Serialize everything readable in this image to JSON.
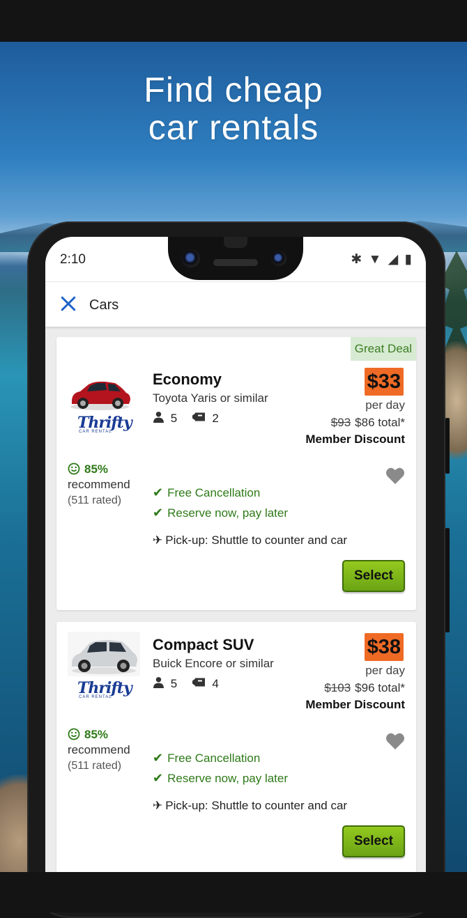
{
  "promo": {
    "headline_line1": "Find cheap",
    "headline_line2": "car rentals"
  },
  "status_bar": {
    "time": "2:10",
    "icons": [
      "bluetooth-icon",
      "wifi-icon",
      "signal-icon",
      "battery-icon"
    ]
  },
  "app_bar": {
    "title": "Cars",
    "close_icon": "close-icon"
  },
  "colors": {
    "accent": "#1b62c7",
    "price": "#ef6a25",
    "green": "#2e7a18",
    "select": "#7fb81a",
    "badge_bg": "#d7ebd2"
  },
  "listings": [
    {
      "badge": "Great Deal",
      "car_class": "Economy",
      "model": "Toyota Yaris or similar",
      "passengers": "5",
      "bags": "2",
      "vendor": "Thrifty",
      "vendor_sub": "CAR RENTAL",
      "price": "$33",
      "per_day": "per day",
      "old_total": "$93",
      "total": "$86 total*",
      "member": "Member Discount",
      "recommend_pct": "85%",
      "recommend_label": "recommend",
      "rated": "(511 rated)",
      "perks": [
        "Free Cancellation",
        "Reserve now, pay later"
      ],
      "pickup": "Pick-up: Shuttle to counter and car",
      "select_label": "Select"
    },
    {
      "badge": "",
      "car_class": "Compact SUV",
      "model": "Buick Encore or similar",
      "passengers": "5",
      "bags": "4",
      "vendor": "Thrifty",
      "vendor_sub": "CAR RENTAL",
      "price": "$38",
      "per_day": "per day",
      "old_total": "$103",
      "total": "$96 total*",
      "member": "Member Discount",
      "recommend_pct": "85%",
      "recommend_label": "recommend",
      "rated": "(511 rated)",
      "perks": [
        "Free Cancellation",
        "Reserve now, pay later"
      ],
      "pickup": "Pick-up: Shuttle to counter and car",
      "select_label": "Select"
    }
  ]
}
